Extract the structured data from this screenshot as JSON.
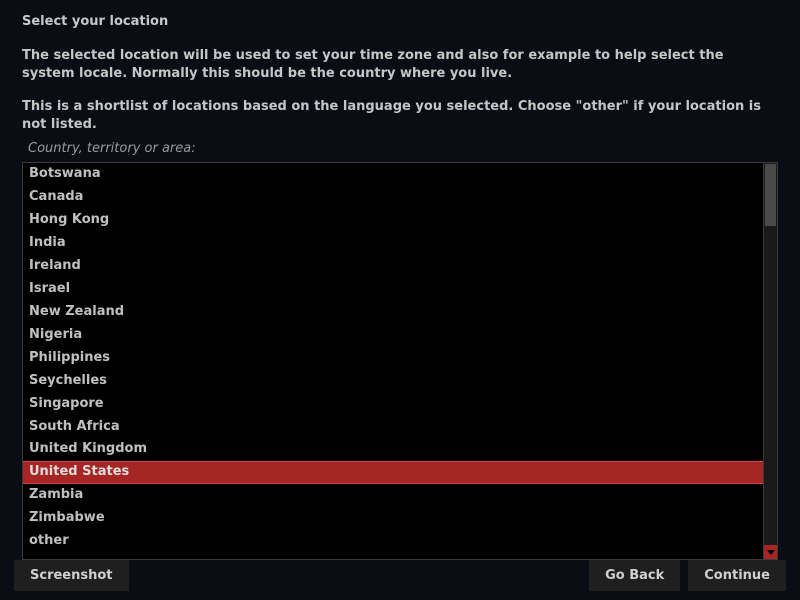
{
  "title": "Select your location",
  "description": "The selected location will be used to set your time zone and also for example to help select the system locale. Normally this should be the country where you live.",
  "description2": "This is a shortlist of locations based on the language you selected. Choose \"other\" if your location is not listed.",
  "field_label": "Country, territory or area:",
  "locations": [
    "Botswana",
    "Canada",
    "Hong Kong",
    "India",
    "Ireland",
    "Israel",
    "New Zealand",
    "Nigeria",
    "Philippines",
    "Seychelles",
    "Singapore",
    "South Africa",
    "United Kingdom",
    "United States",
    "Zambia",
    "Zimbabwe",
    "other"
  ],
  "selected_index": 13,
  "buttons": {
    "screenshot": "Screenshot",
    "go_back": "Go Back",
    "continue": "Continue"
  }
}
